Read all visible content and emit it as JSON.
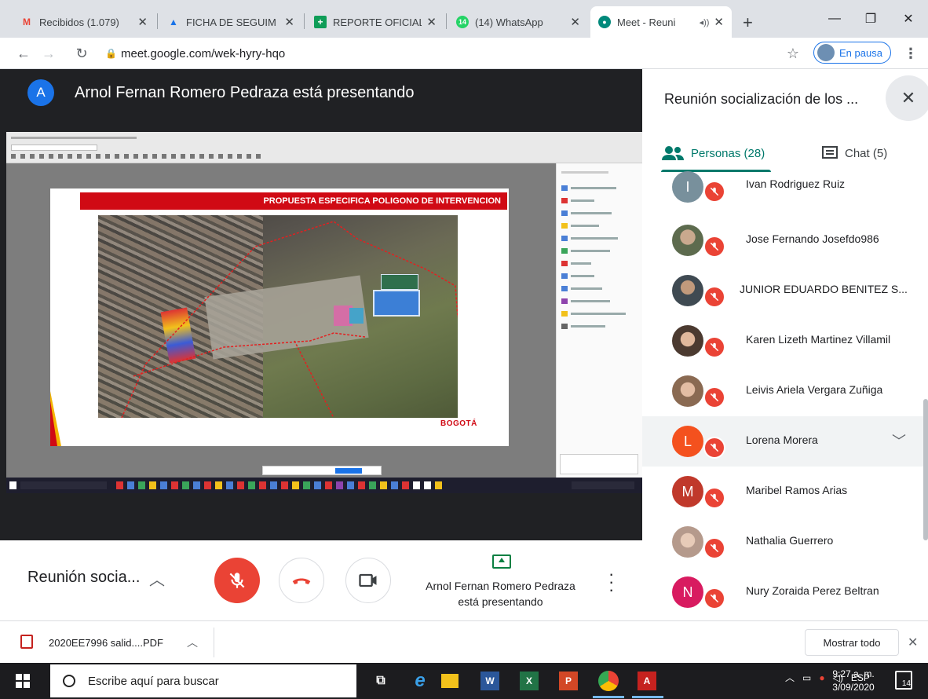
{
  "browser": {
    "tabs": [
      {
        "label": "Recibidos (1.079)",
        "icon": "gmail-icon",
        "color": "#ea4335"
      },
      {
        "label": "FICHA DE SEGUIM",
        "icon": "drive-icon",
        "color": "#1a73e8"
      },
      {
        "label": "REPORTE OFICIAL",
        "icon": "sheets-icon",
        "color": "#0f9d58"
      },
      {
        "label": "(14) WhatsApp",
        "icon": "whatsapp-icon",
        "color": "#25d366"
      },
      {
        "label": "Meet - Reuni",
        "icon": "meet-icon",
        "color": "#00897b"
      }
    ],
    "url": "meet.google.com/wek-hyry-hqo",
    "profile_label": "En pausa"
  },
  "stage": {
    "presenter_initial": "A",
    "presenter_title": "Arnol Fernan Romero Pedraza está presentando",
    "slide_header": "PROPUESTA ESPECIFICA POLIGONO DE INTERVENCION",
    "slide_logo": "BOGOTÁ"
  },
  "controls": {
    "meeting_title": "Reunión socia...",
    "present_label_line1": "Arnol Fernan Romero Pedraza",
    "present_label_line2": "está presentando"
  },
  "panel": {
    "title": "Reunión socialización de los ...",
    "people_tab": "Personas (28)",
    "chat_tab": "Chat (5)",
    "participants": [
      {
        "name": "Ivan Rodriguez Ruiz",
        "initial": "I",
        "avatar_color": "#78909c",
        "photo": false
      },
      {
        "name": "Jose Fernando Josefdo986",
        "initial": "",
        "avatar_color": "#5d6b4e",
        "photo": true
      },
      {
        "name": "JUNIOR EDUARDO BENITEZ S...",
        "initial": "",
        "avatar_color": "#3f4a52",
        "photo": true
      },
      {
        "name": "Karen Lizeth Martinez Villamil",
        "initial": "",
        "avatar_color": "#6b5546",
        "photo": true
      },
      {
        "name": "Leivis Ariela Vergara Zuñiga",
        "initial": "",
        "avatar_color": "#8a6a52",
        "photo": true
      },
      {
        "name": "Lorena Morera",
        "initial": "L",
        "avatar_color": "#f4511e",
        "photo": false
      },
      {
        "name": "Maribel Ramos Arias",
        "initial": "M",
        "avatar_color": "#c0392b",
        "photo": false
      },
      {
        "name": "Nathalia Guerrero",
        "initial": "",
        "avatar_color": "#b59a8c",
        "photo": true
      },
      {
        "name": "Nury Zoraida Perez Beltran",
        "initial": "N",
        "avatar_color": "#d81b60",
        "photo": false
      }
    ]
  },
  "downloads": {
    "file": "2020EE7996 salid....PDF",
    "show_all": "Mostrar todo"
  },
  "taskbar": {
    "search_placeholder": "Escribe aquí para buscar",
    "language": "ESP",
    "time": "9:27 a. m.",
    "date": "3/09/2020",
    "notifications": "14"
  }
}
